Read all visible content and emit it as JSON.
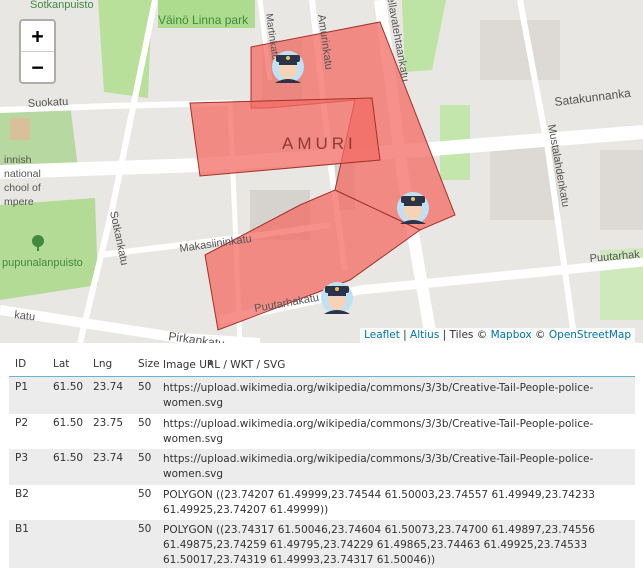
{
  "map": {
    "zoom_in": "+",
    "zoom_out": "−",
    "labels": {
      "park1": "Väinö Linna park",
      "sotkanpuisto": "Sotkanpuisto",
      "suokatu": "Suokatu",
      "satakunnankatu": "Satakunnanka",
      "amuri": "AMURI",
      "mustalahdenkatu": "Mustalahdenkatu",
      "makasiininkatu": "Makasiininkatu",
      "puutarhakatu_right": "Puutarhak",
      "puutarhakatu": "Puutarhakatu",
      "pirkankatu": "Pirkankatu",
      "sotkankatu": "Sotkankatu",
      "amurinkatu": "Amurinkatu",
      "pellavatehtaankatu": "Pellavatehtaankatu",
      "school": "innish\nnational\nchool of\nmpere",
      "pupunalanpuisto": "pupunalanpuisto",
      "katu_left": "katu",
      "martinkatu": "Martinkatu"
    },
    "attribution": {
      "leaflet": "Leaflet",
      "sep1": " | ",
      "altius": "Altius",
      "tiles": " | Tiles © ",
      "mapbox": "Mapbox",
      "copy": " © ",
      "osm": "OpenStreetMap"
    },
    "colors": {
      "polygon_fill": "#f26b63",
      "polygon_stroke": "#a3312a"
    },
    "markers_icon": "police-woman-icon"
  },
  "table": {
    "headers": {
      "id": "ID",
      "lat": "Lat",
      "lng": "Lng",
      "size": "Size",
      "url": "Image URL / WKT / SVG"
    },
    "sorted_column": "url",
    "rows": [
      {
        "id": "P1",
        "lat": "61.50",
        "lng": "23.74",
        "size": "50",
        "url": "https://upload.wikimedia.org/wikipedia/commons/3/3b/Creative-Tail-People-police-women.svg"
      },
      {
        "id": "P2",
        "lat": "61.50",
        "lng": "23.75",
        "size": "50",
        "url": "https://upload.wikimedia.org/wikipedia/commons/3/3b/Creative-Tail-People-police-women.svg"
      },
      {
        "id": "P3",
        "lat": "61.50",
        "lng": "23.74",
        "size": "50",
        "url": "https://upload.wikimedia.org/wikipedia/commons/3/3b/Creative-Tail-People-police-women.svg"
      },
      {
        "id": "B2",
        "lat": "",
        "lng": "",
        "size": "50",
        "url": "POLYGON ((23.74207 61.49999,23.74544 61.50003,23.74557 61.49949,23.74233 61.49925,23.74207 61.49999))"
      },
      {
        "id": "B1",
        "lat": "",
        "lng": "",
        "size": "50",
        "url": "POLYGON ((23.74317 61.50046,23.74604 61.50073,23.74700 61.49897,23.74556 61.49875,23.74259 61.49795,23.74229 61.49865,23.74463 61.49925,23.74533 61.50017,23.74319 61.49993,23.74317 61.50046))"
      }
    ]
  }
}
